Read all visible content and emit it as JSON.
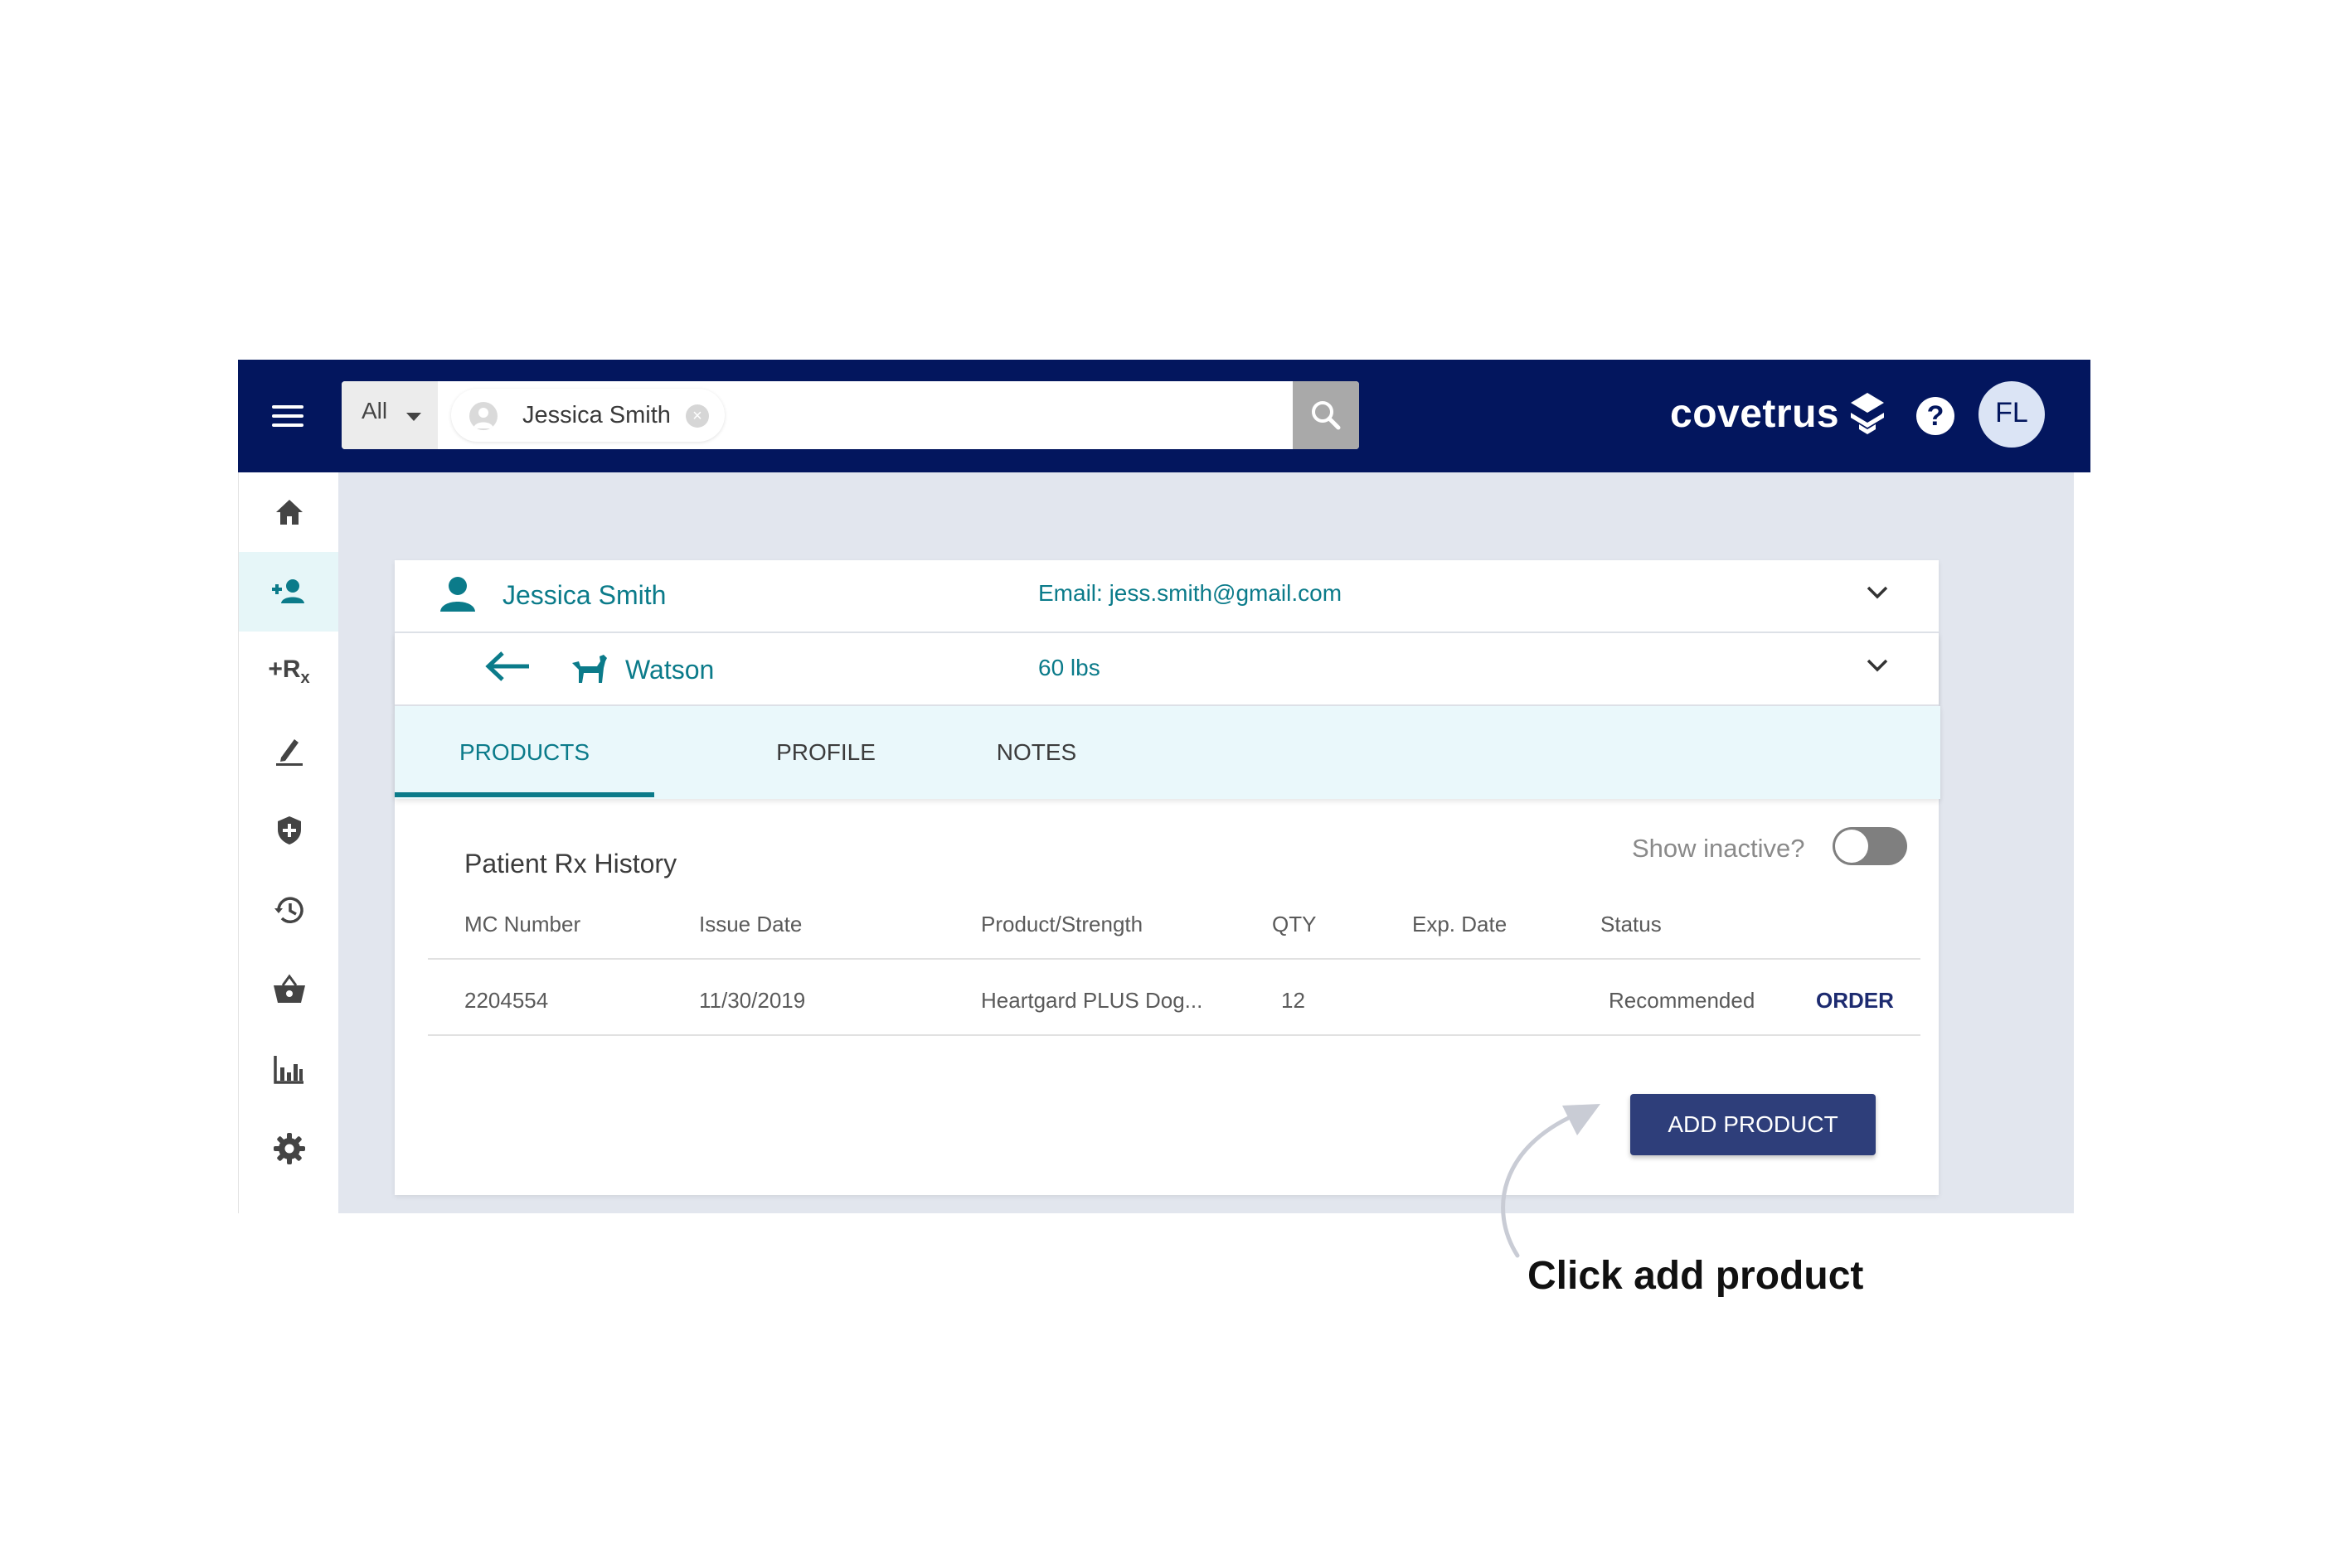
{
  "header": {
    "search_scope": "All",
    "search_chip": "Jessica Smith",
    "brand": "covetrus",
    "help": "?",
    "user_initials": "FL"
  },
  "sidebar": {
    "items": [
      {
        "icon": "home-icon"
      },
      {
        "icon": "add-person-icon",
        "active": true
      },
      {
        "icon": "add-rx-icon",
        "label": "+R"
      },
      {
        "icon": "pencil-icon"
      },
      {
        "icon": "shield-plus-icon"
      },
      {
        "icon": "history-icon"
      },
      {
        "icon": "basket-icon"
      },
      {
        "icon": "bar-chart-icon"
      },
      {
        "icon": "gear-icon"
      }
    ]
  },
  "client": {
    "name": "Jessica Smith",
    "email_label": "Email:  jess.smith@gmail.com"
  },
  "patient": {
    "name": "Watson",
    "weight": "60 lbs"
  },
  "tabs": [
    "PRODUCTS",
    "PROFILE",
    "NOTES"
  ],
  "history": {
    "title": "Patient Rx History",
    "toggle_label": "Show inactive?",
    "show_inactive": false,
    "columns": [
      "MC Number",
      "Issue Date",
      "Product/Strength",
      "QTY",
      "Exp. Date",
      "Status"
    ],
    "rows": [
      {
        "mc_number": "2204554",
        "issue_date": "11/30/2019",
        "product": "Heartgard PLUS Dog...",
        "qty": "12",
        "exp_date": "",
        "status": "Recommended",
        "action": "ORDER"
      }
    ]
  },
  "add_product_label": "ADD PRODUCT",
  "annotation": "Click add product",
  "colors": {
    "topbar": "#03165e",
    "teal": "#0b7b8a",
    "button": "#2e3e7a",
    "content_bg": "#e2e6ee"
  }
}
